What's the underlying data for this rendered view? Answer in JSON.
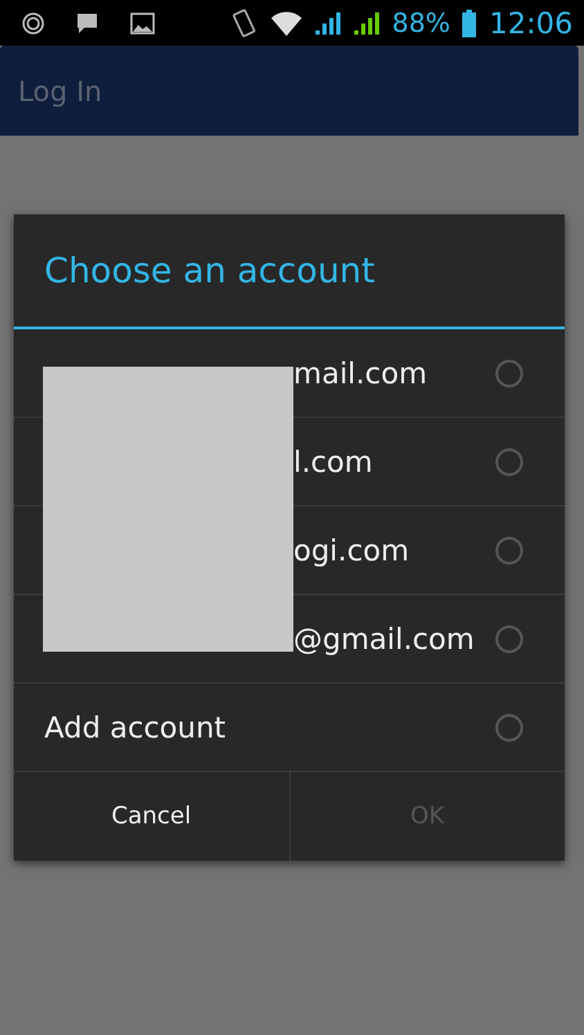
{
  "status_bar": {
    "battery": "88%",
    "time": "12:06"
  },
  "app_bar": {
    "title": "Log In"
  },
  "dialog": {
    "title": "Choose an account",
    "options": [
      {
        "kind": "account",
        "label": "mail.com",
        "selected": false
      },
      {
        "kind": "account",
        "label": "l.com",
        "selected": false
      },
      {
        "kind": "account",
        "label": "ogi.com",
        "selected": false
      },
      {
        "kind": "account",
        "label": "@gmail.com",
        "selected": false
      },
      {
        "kind": "add",
        "label": "Add account",
        "selected": false
      }
    ],
    "buttons": [
      {
        "label": "Cancel",
        "disabled": false
      },
      {
        "label": "OK",
        "disabled": true
      }
    ]
  }
}
